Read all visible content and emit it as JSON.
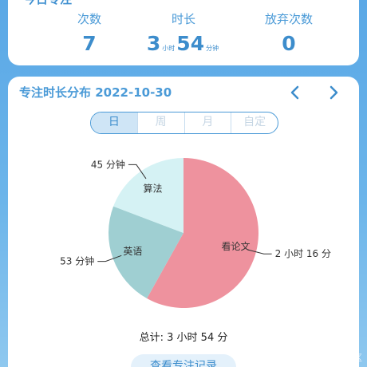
{
  "today": {
    "title": "今日专注",
    "stats": [
      {
        "label": "次数",
        "value": "7"
      },
      {
        "label": "时长",
        "hours": "3",
        "hours_unit": "小时",
        "minutes": "54",
        "minutes_unit": "分钟"
      },
      {
        "label": "放弃次数",
        "value": "0"
      }
    ]
  },
  "distribution": {
    "title": "专注时长分布 2022-10-30",
    "tabs": [
      "日",
      "周",
      "月",
      "自定"
    ],
    "active_tab": "日",
    "total_text": "总计: 3 小时 54 分",
    "record_button": "查看专注记录"
  },
  "chart_data": {
    "type": "pie",
    "slices": [
      {
        "name": "看论文",
        "value": 136,
        "value_label": "2 小时 16 分",
        "color": "#ee929e"
      },
      {
        "name": "英语",
        "value": 53,
        "value_label": "53 分钟",
        "color": "#9fcfd2"
      },
      {
        "name": "算法",
        "value": 45,
        "value_label": "45 分钟",
        "color": "#d5f2f4"
      }
    ]
  },
  "watermark": "@稀土掘金技术社区",
  "colors": {
    "accent": "#3d8dcc",
    "background": "#5aa8e6"
  }
}
